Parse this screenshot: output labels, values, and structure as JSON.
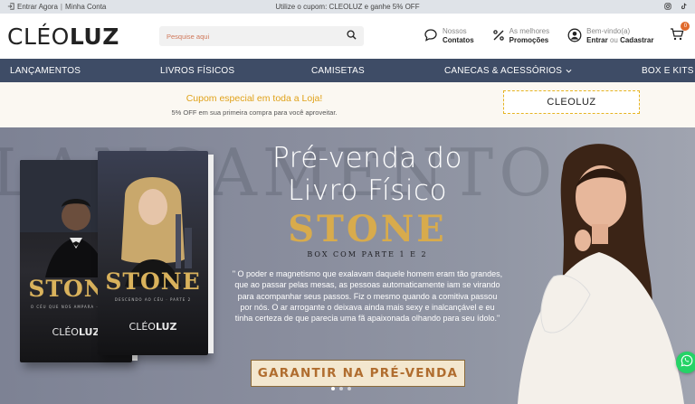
{
  "topbar": {
    "login_label": "Entrar Agora",
    "separator": "|",
    "account_label": "Minha Conta",
    "promo": "Utilize o cupom: CLEOLUZ e ganhe 5% OFF"
  },
  "header": {
    "logo_light": "CLÉO",
    "logo_bold": "LUZ",
    "search_placeholder": "Pesquise aqui",
    "contacts_line1": "Nossos",
    "contacts_line2": "Contatos",
    "promos_line1": "As melhores",
    "promos_line2": "Promoções",
    "account_line1": "Bem-vindo(a)",
    "account_login": "Entrar",
    "account_or": "ou",
    "account_register": "Cadastrar",
    "cart_count": "0"
  },
  "nav": {
    "items": [
      "LANÇAMENTOS",
      "LIVROS FÍSICOS",
      "CAMISETAS",
      "CANECAS & ACESSÓRIOS",
      "BOX E KITS"
    ]
  },
  "coupon": {
    "title": "Cupom especial em toda a Loja!",
    "subtitle": "5% OFF em sua primeira compra para você aproveitar.",
    "code": "CLEOLUZ"
  },
  "hero": {
    "bg_word": "LANÇAMENTO",
    "headline_line1": "Pré-venda do",
    "headline_line2": "Livro Físico",
    "title": "STONE",
    "subtitle": "BOX COM PARTE 1 E 2",
    "quote": "\" O poder e magnetismo que exalavam daquele homem eram tão grandes, que ao passar pelas mesas, as pessoas automaticamente iam se virando para acompanhar seus passos. Fiz o mesmo quando a comitiva passou por nós. O ar arrogante o deixava ainda mais sexy e inalcançável e eu tinha certeza de que parecia uma fã apaixonada olhando para seu ídolo.\"",
    "cta": "GARANTIR NA PRÉ-VENDA",
    "book1_title": "STONE",
    "book1_tagline": "O CÉU QUE NOS AMPARA · PARTE 1",
    "book2_title": "STONE",
    "book2_tagline": "DESCENDO AO CÉU · PARTE 2",
    "book_author_light": "CLÉO",
    "book_author_bold": "LUZ",
    "slides": 3,
    "active_slide": 0
  },
  "colors": {
    "nav_bg": "#3e4c66",
    "accent": "#e0a21a",
    "gold": "#d8ab4c",
    "whatsapp": "#25d366"
  }
}
